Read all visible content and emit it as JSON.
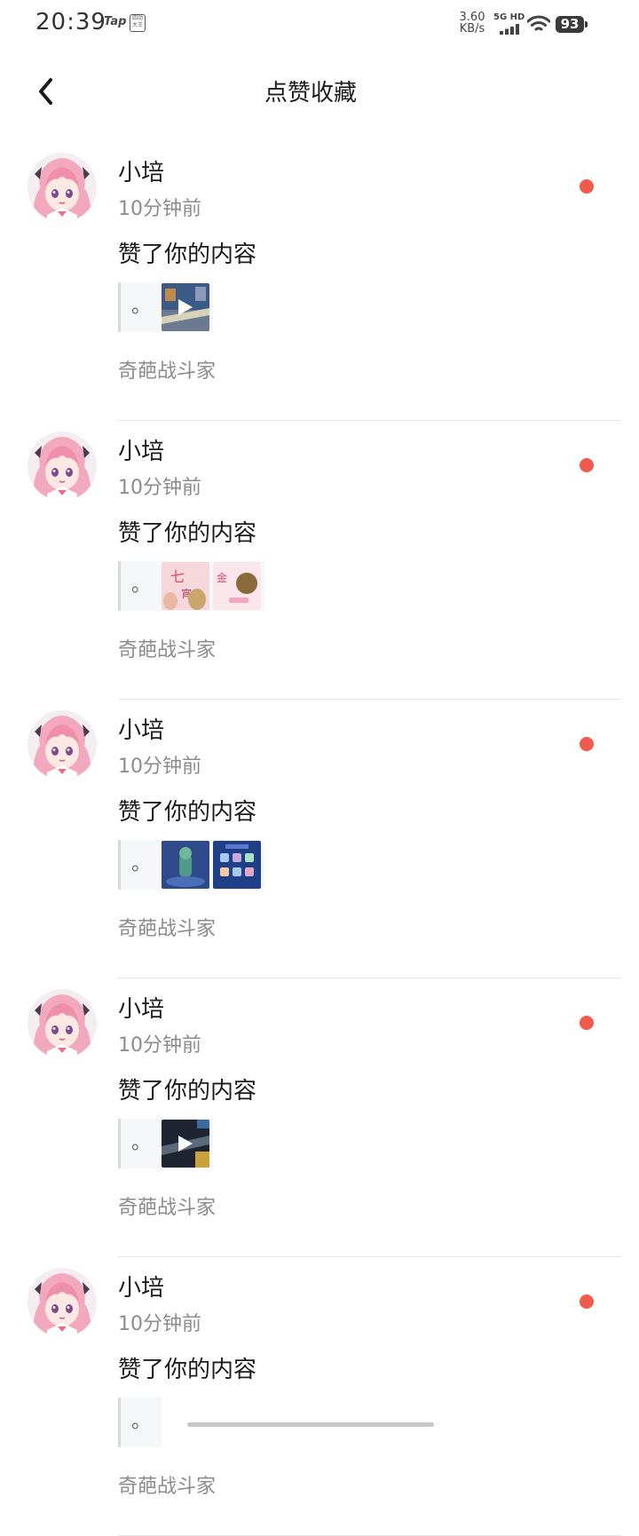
{
  "status_bar": {
    "time": "20:39",
    "tap_label": "Tap",
    "badge_text": "四动大王",
    "speed_value": "3.60",
    "speed_unit": "KB/s",
    "network": "5G HD",
    "battery": "93"
  },
  "header": {
    "title": "点赞收藏",
    "back_icon": "chevron-left-icon"
  },
  "notifications": [
    {
      "user": "小培",
      "time": "10分钟前",
      "action": "赞了你的内容",
      "quote": "。",
      "thumbnails": [
        {
          "type": "video",
          "tone": "game-road"
        }
      ],
      "game": "奇葩战斗家"
    },
    {
      "user": "小培",
      "time": "10分钟前",
      "action": "赞了你的内容",
      "quote": "。",
      "thumbnails": [
        {
          "type": "image",
          "tone": "pink-event"
        },
        {
          "type": "image",
          "tone": "pink-gold"
        }
      ],
      "game": "奇葩战斗家"
    },
    {
      "user": "小培",
      "time": "10分钟前",
      "action": "赞了你的内容",
      "quote": "。",
      "thumbnails": [
        {
          "type": "image",
          "tone": "blue-character"
        },
        {
          "type": "image",
          "tone": "blue-grid"
        }
      ],
      "game": "奇葩战斗家"
    },
    {
      "user": "小培",
      "time": "10分钟前",
      "action": "赞了你的内容",
      "quote": "。",
      "thumbnails": [
        {
          "type": "video",
          "tone": "game-dark"
        }
      ],
      "game": "奇葩战斗家"
    },
    {
      "user": "小培",
      "time": "10分钟前",
      "action": "赞了你的内容",
      "quote": "。",
      "thumbnails": [],
      "game": "奇葩战斗家"
    }
  ],
  "colors": {
    "unread_dot": "#f25a4e",
    "secondary_text": "#8c8c8c",
    "quote_background": "#f6f7f9"
  }
}
